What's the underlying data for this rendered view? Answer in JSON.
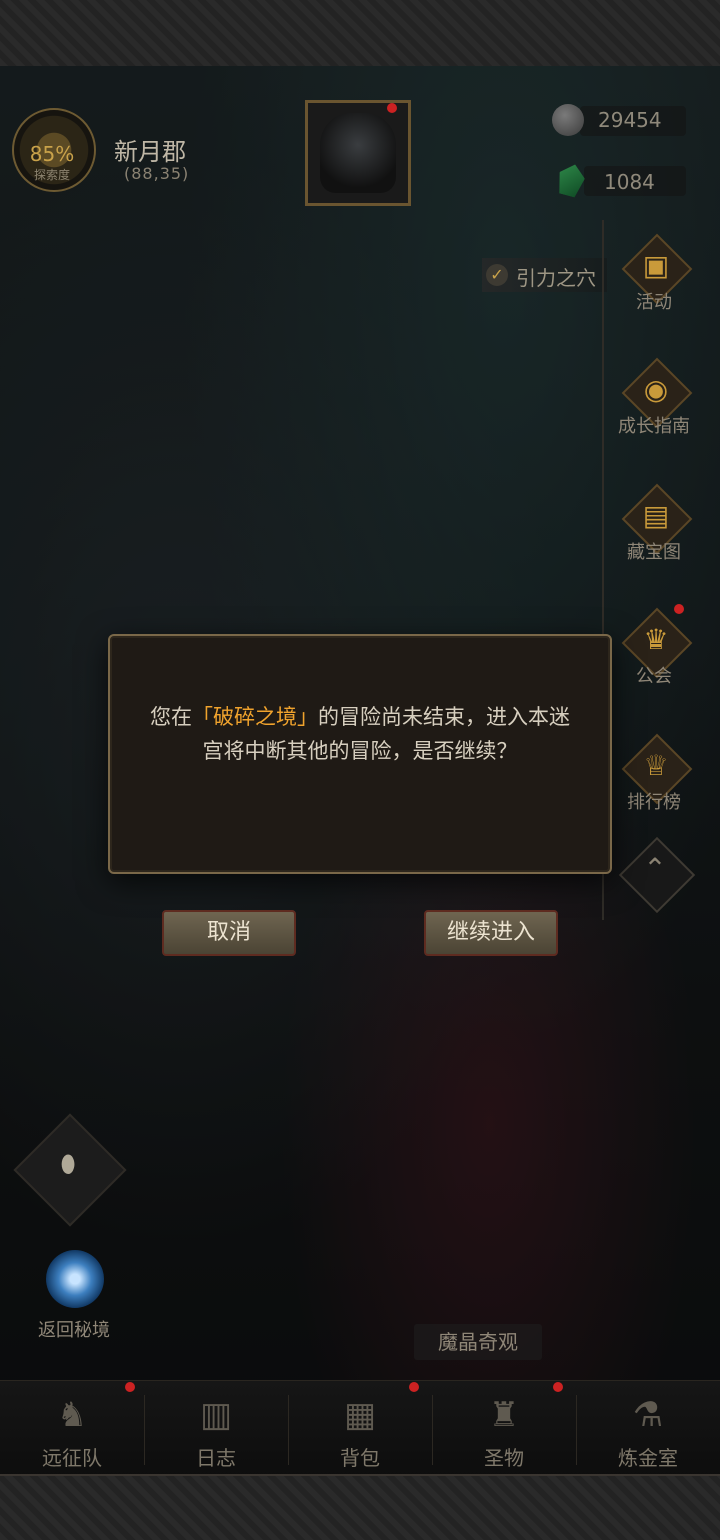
{
  "header": {
    "explore_percent": "85%",
    "explore_label": "探索度",
    "region_name": "新月郡",
    "region_coord": "(88,35)"
  },
  "currencies": {
    "coins": "29454",
    "gems": "1084"
  },
  "quest_tracker": {
    "label": "引力之穴"
  },
  "side_menu": {
    "items": [
      {
        "label": "活动",
        "icon": "gift-icon"
      },
      {
        "label": "成长指南",
        "icon": "guide-icon"
      },
      {
        "label": "藏宝图",
        "icon": "treasure-map-icon"
      },
      {
        "label": "公会",
        "icon": "guild-icon"
      },
      {
        "label": "排行榜",
        "icon": "trophy-icon"
      }
    ]
  },
  "dialog": {
    "text_before": "您在",
    "highlight": "「破碎之境」",
    "text_after": "的冒险尚未结束，进入本迷宫将中断其他的冒险，是否继续？",
    "cancel_label": "取消",
    "confirm_label": "继续进入"
  },
  "left_actions": {
    "return_label": "返回秘境"
  },
  "area_label": "魔晶奇观",
  "bottom_nav": {
    "items": [
      {
        "label": "远征队",
        "icon": "helmet-icon"
      },
      {
        "label": "日志",
        "icon": "scroll-icon"
      },
      {
        "label": "背包",
        "icon": "backpack-icon"
      },
      {
        "label": "圣物",
        "icon": "relic-icon"
      },
      {
        "label": "炼金室",
        "icon": "alchemy-icon"
      }
    ]
  },
  "colors": {
    "accent_gold": "#c9a24a",
    "highlight_orange": "#f0a32d",
    "notify_red": "#cc2222"
  }
}
